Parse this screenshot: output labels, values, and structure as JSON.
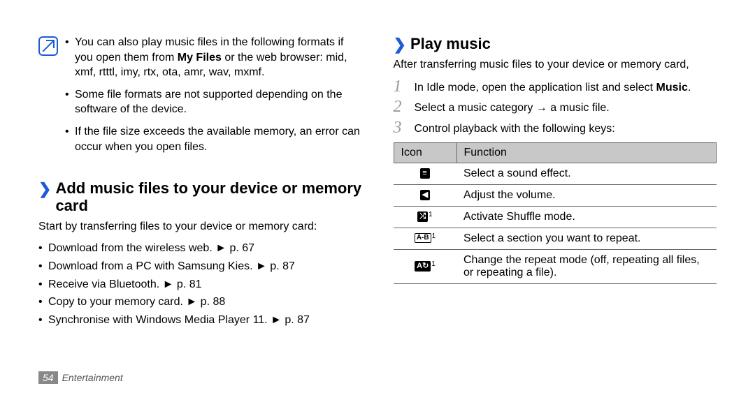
{
  "note": {
    "items": [
      {
        "pre": "You can also play music files in the following formats if you open them from ",
        "bold": "My Files",
        "post": " or the web browser: mid, xmf, rtttl, imy, rtx, ota, amr, wav, mxmf."
      },
      {
        "pre": "Some file formats are not supported depending on the software of the device.",
        "bold": "",
        "post": ""
      },
      {
        "pre": "If the file size exceeds the available memory, an error can occur when you open files.",
        "bold": "",
        "post": ""
      }
    ]
  },
  "sectionAdd": {
    "title": "Add music files to your device or memory card",
    "intro": "Start by transferring files to your device or memory card:",
    "bullets": [
      "Download from the wireless web. ► p. 67",
      "Download from a PC with Samsung Kies. ► p. 87",
      "Receive via Bluetooth. ► p. 81",
      "Copy to your memory card. ► p. 88",
      "Synchronise with Windows Media Player 11. ► p. 87"
    ]
  },
  "sectionPlay": {
    "title": "Play music",
    "intro": "After transferring music files to your device or memory card,",
    "steps": [
      {
        "num": "1",
        "pre": "In Idle mode, open the application list and select ",
        "bold": "Music",
        "post": "."
      },
      {
        "num": "2",
        "pre": "Select a music category → a music file.",
        "bold": "",
        "post": ""
      },
      {
        "num": "3",
        "pre": "Control playback with the following keys:",
        "bold": "",
        "post": ""
      }
    ],
    "table": {
      "headers": {
        "icon": "Icon",
        "func": "Function"
      },
      "rows": [
        {
          "iconName": "equalizer-icon",
          "iconGlyph": "≡",
          "sup": "",
          "func": "Select a sound effect."
        },
        {
          "iconName": "volume-icon",
          "iconGlyph": "◀",
          "sup": "",
          "func": "Adjust the volume."
        },
        {
          "iconName": "shuffle-icon",
          "iconGlyph": "⤮",
          "sup": "1",
          "func": "Activate Shuffle mode."
        },
        {
          "iconName": "repeat-section-icon",
          "iconGlyph": "A-B",
          "sup": "1",
          "func": "Select a section you want to repeat."
        },
        {
          "iconName": "repeat-mode-icon",
          "iconGlyph": "A↻",
          "sup": "1",
          "func": "Change the repeat mode (off, repeating all files, or repeating a file)."
        }
      ]
    }
  },
  "footer": {
    "page": "54",
    "section": "Entertainment"
  }
}
